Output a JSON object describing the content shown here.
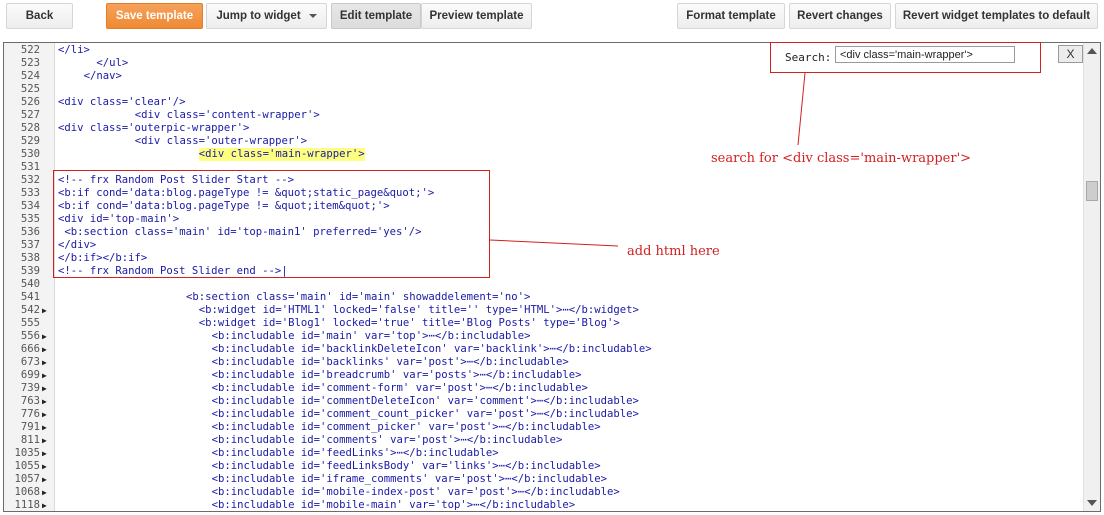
{
  "toolbar": {
    "back": "Back",
    "save": "Save template",
    "jump": "Jump to widget",
    "edit": "Edit template",
    "preview": "Preview template",
    "format": "Format template",
    "revert": "Revert changes",
    "revert_widgets": "Revert widget templates to default"
  },
  "search": {
    "label": "Search:",
    "value": "<div class='main-wrapper'>",
    "close": "X"
  },
  "annotations": {
    "search_note": "search for <div class='main-wrapper'>",
    "add_note": "add html here"
  },
  "lines": [
    {
      "num": "522",
      "fold": "",
      "indent": 0,
      "code": "</li>"
    },
    {
      "num": "523",
      "fold": "",
      "indent": 6,
      "code": "</ul>"
    },
    {
      "num": "524",
      "fold": "",
      "indent": 4,
      "code": "</nav>"
    },
    {
      "num": "525",
      "fold": "",
      "indent": 0,
      "code": ""
    },
    {
      "num": "526",
      "fold": "",
      "indent": 0,
      "code": "<div class='clear'/>"
    },
    {
      "num": "527",
      "fold": "",
      "indent": 12,
      "code": "<div class='content-wrapper'>"
    },
    {
      "num": "528",
      "fold": "",
      "indent": 0,
      "code": "<div class='outerpic-wrapper'>"
    },
    {
      "num": "529",
      "fold": "",
      "indent": 12,
      "code": "<div class='outer-wrapper'>"
    },
    {
      "num": "530",
      "fold": "",
      "indent": 22,
      "code": "<div class='main-wrapper'>",
      "highlight": true
    },
    {
      "num": "531",
      "fold": "",
      "indent": 0,
      "code": ""
    },
    {
      "num": "532",
      "fold": "",
      "indent": 0,
      "code": "<!-- frx Random Post Slider Start -->"
    },
    {
      "num": "533",
      "fold": "",
      "indent": 0,
      "code": "<b:if cond='data:blog.pageType != &quot;static_page&quot;'>"
    },
    {
      "num": "534",
      "fold": "",
      "indent": 0,
      "code": "<b:if cond='data:blog.pageType != &quot;item&quot;'>"
    },
    {
      "num": "535",
      "fold": "",
      "indent": 0,
      "code": "<div id='top-main'>"
    },
    {
      "num": "536",
      "fold": "",
      "indent": 1,
      "code": "<b:section class='main' id='top-main1' preferred='yes'/>"
    },
    {
      "num": "537",
      "fold": "",
      "indent": 0,
      "code": "</div>"
    },
    {
      "num": "538",
      "fold": "",
      "indent": 0,
      "code": "</b:if></b:if>"
    },
    {
      "num": "539",
      "fold": "",
      "indent": 0,
      "code": "<!-- frx Random Post Slider end -->|"
    },
    {
      "num": "540",
      "fold": "",
      "indent": 0,
      "code": ""
    },
    {
      "num": "541",
      "fold": "",
      "indent": 20,
      "code": "<b:section class='main' id='main' showaddelement='no'>"
    },
    {
      "num": "542",
      "fold": "▶",
      "indent": 22,
      "code": "<b:widget id='HTML1' locked='false' title='' type='HTML'>⋯</b:widget>"
    },
    {
      "num": "555",
      "fold": "",
      "indent": 22,
      "code": "<b:widget id='Blog1' locked='true' title='Blog Posts' type='Blog'>"
    },
    {
      "num": "556",
      "fold": "▶",
      "indent": 24,
      "code": "<b:includable id='main' var='top'>⋯</b:includable>"
    },
    {
      "num": "666",
      "fold": "▶",
      "indent": 24,
      "code": "<b:includable id='backlinkDeleteIcon' var='backlink'>⋯</b:includable>"
    },
    {
      "num": "673",
      "fold": "▶",
      "indent": 24,
      "code": "<b:includable id='backlinks' var='post'>⋯</b:includable>"
    },
    {
      "num": "699",
      "fold": "▶",
      "indent": 24,
      "code": "<b:includable id='breadcrumb' var='posts'>⋯</b:includable>"
    },
    {
      "num": "739",
      "fold": "▶",
      "indent": 24,
      "code": "<b:includable id='comment-form' var='post'>⋯</b:includable>"
    },
    {
      "num": "763",
      "fold": "▶",
      "indent": 24,
      "code": "<b:includable id='commentDeleteIcon' var='comment'>⋯</b:includable>"
    },
    {
      "num": "776",
      "fold": "▶",
      "indent": 24,
      "code": "<b:includable id='comment_count_picker' var='post'>⋯</b:includable>"
    },
    {
      "num": "791",
      "fold": "▶",
      "indent": 24,
      "code": "<b:includable id='comment_picker' var='post'>⋯</b:includable>"
    },
    {
      "num": "811",
      "fold": "▶",
      "indent": 24,
      "code": "<b:includable id='comments' var='post'>⋯</b:includable>"
    },
    {
      "num": "1035",
      "fold": "▶",
      "indent": 24,
      "code": "<b:includable id='feedLinks'>⋯</b:includable>"
    },
    {
      "num": "1055",
      "fold": "▶",
      "indent": 24,
      "code": "<b:includable id='feedLinksBody' var='links'>⋯</b:includable>"
    },
    {
      "num": "1057",
      "fold": "▶",
      "indent": 24,
      "code": "<b:includable id='iframe_comments' var='post'>⋯</b:includable>"
    },
    {
      "num": "1068",
      "fold": "▶",
      "indent": 24,
      "code": "<b:includable id='mobile-index-post' var='post'>⋯</b:includable>"
    },
    {
      "num": "1118",
      "fold": "▶",
      "indent": 24,
      "code": "<b:includable id='mobile-main' var='top'>⋯</b:includable>"
    }
  ]
}
